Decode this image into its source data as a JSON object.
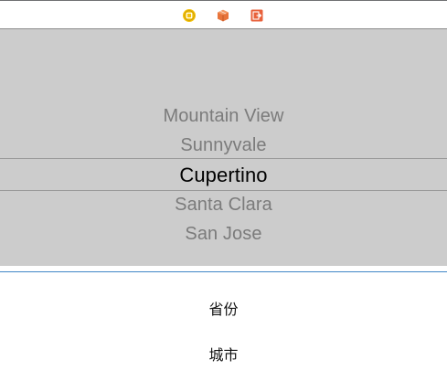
{
  "scene_dock": {
    "icons": [
      {
        "name": "view-controller-icon",
        "color": "#f4c20d"
      },
      {
        "name": "first-responder-icon",
        "color": "#e8743b"
      },
      {
        "name": "exit-icon",
        "color": "#e8613b"
      }
    ]
  },
  "picker": {
    "rows": [
      "Mountain View",
      "Sunnyvale",
      "Cupertino",
      "Santa Clara",
      "San Jose"
    ],
    "selected": "Cupertino",
    "background": "#cccccc"
  },
  "labels": {
    "province": "省份",
    "city": "城市"
  },
  "colors": {
    "divider": "#3f86c7",
    "unselected_text": "#7b7b7b",
    "selected_text": "#000000"
  }
}
